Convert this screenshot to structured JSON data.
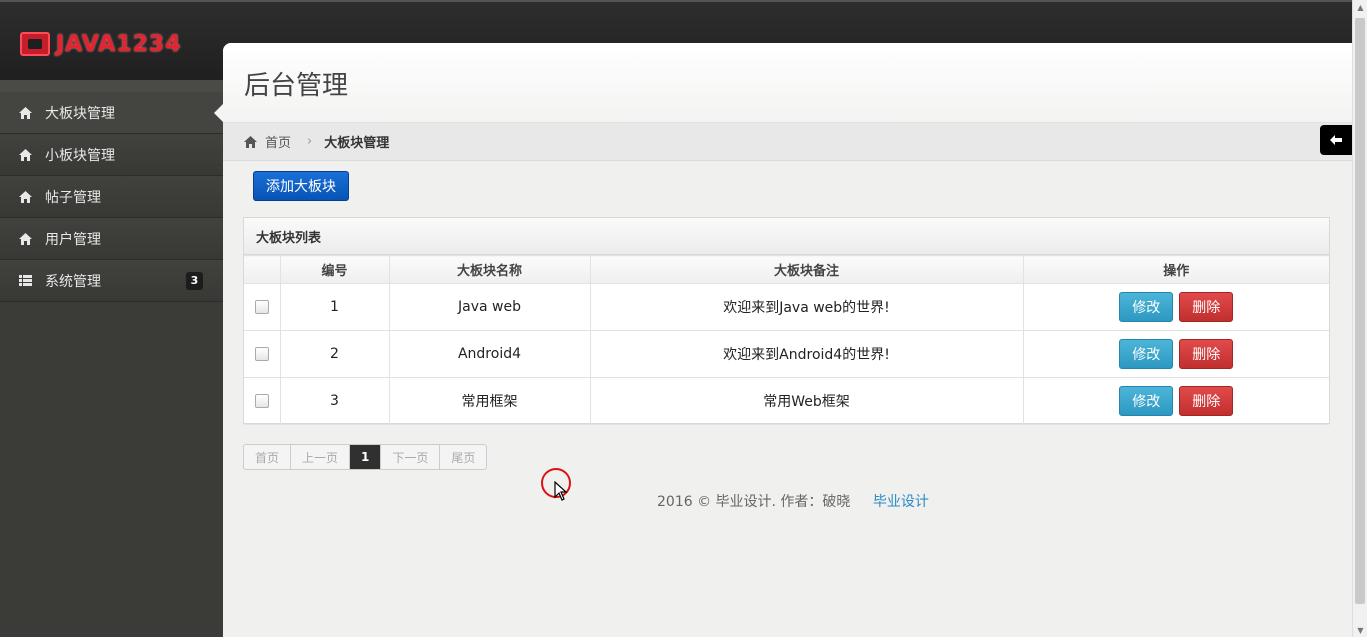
{
  "brand": {
    "logo_text": "JAVA1234"
  },
  "sidebar": {
    "items": [
      {
        "label": "大板块管理",
        "icon": "home-icon",
        "active": true
      },
      {
        "label": "小板块管理",
        "icon": "home-icon"
      },
      {
        "label": "帖子管理",
        "icon": "home-icon"
      },
      {
        "label": "用户管理",
        "icon": "home-icon"
      },
      {
        "label": "系统管理",
        "icon": "list-icon",
        "badge": "3"
      }
    ]
  },
  "header": {
    "title": "后台管理"
  },
  "breadcrumb": {
    "home": "首页",
    "current": "大板块管理"
  },
  "toolbar": {
    "add_label": "添加大板块"
  },
  "panel": {
    "title": "大板块列表",
    "columns": [
      "编号",
      "大板块名称",
      "大板块备注",
      "操作"
    ],
    "rows": [
      {
        "id": "1",
        "name": "Java web",
        "remark": "欢迎来到Java web的世界!"
      },
      {
        "id": "2",
        "name": "Android4",
        "remark": "欢迎来到Android4的世界!"
      },
      {
        "id": "3",
        "name": "常用框架",
        "remark": "常用Web框架"
      }
    ],
    "edit_label": "修改",
    "delete_label": "删除"
  },
  "pager": {
    "first": "首页",
    "prev": "上一页",
    "current": "1",
    "next": "下一页",
    "last": "尾页"
  },
  "footer": {
    "text": "2016 © 毕业设计. 作者：破晓",
    "link": "毕业设计"
  },
  "colors": {
    "primary": "#0a5fc4",
    "info": "#3aa6cf",
    "danger": "#cf3a3a",
    "sidebar": "#3b3b38"
  }
}
